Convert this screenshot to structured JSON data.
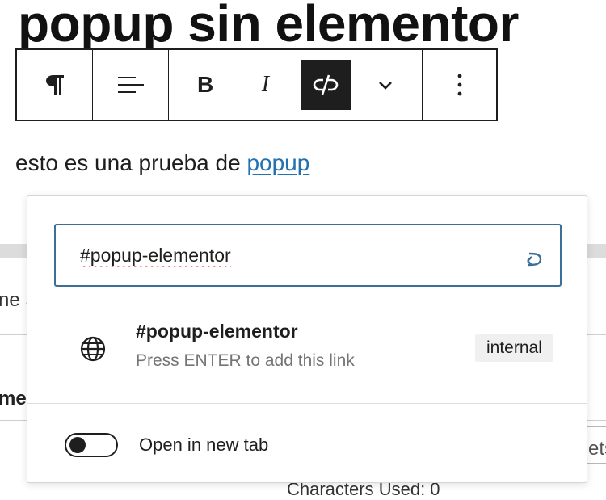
{
  "page": {
    "heading": "popup sin elementor",
    "paragraph_text": "esto es una prueba de ",
    "paragraph_link": "popup"
  },
  "toolbar": {
    "paragraph_icon": "pilcrow-icon",
    "align_icon": "align-icon",
    "bold_label": "B",
    "italic_label": "I",
    "unlink_icon": "unlink-icon",
    "more_formats_icon": "chevron-down-icon",
    "options_icon": "more-vertical-icon",
    "active_color": "#1e1e1e"
  },
  "link_popover": {
    "url_value": "#popup-elementor",
    "submit_icon": "enter-icon",
    "suggestion": {
      "icon": "globe-icon",
      "title": "#popup-elementor",
      "hint": "Press ENTER to add this link",
      "badge": "internal"
    },
    "new_tab_label": "Open in new tab",
    "new_tab_enabled": false,
    "accent_color": "#3c6e96",
    "link_color": "#2271b1"
  },
  "background": {
    "fragment_left_top": "ne S",
    "fragment_left_bottom": "me",
    "fragment_right": "ets",
    "characters_used": "Characters Used: 0"
  }
}
